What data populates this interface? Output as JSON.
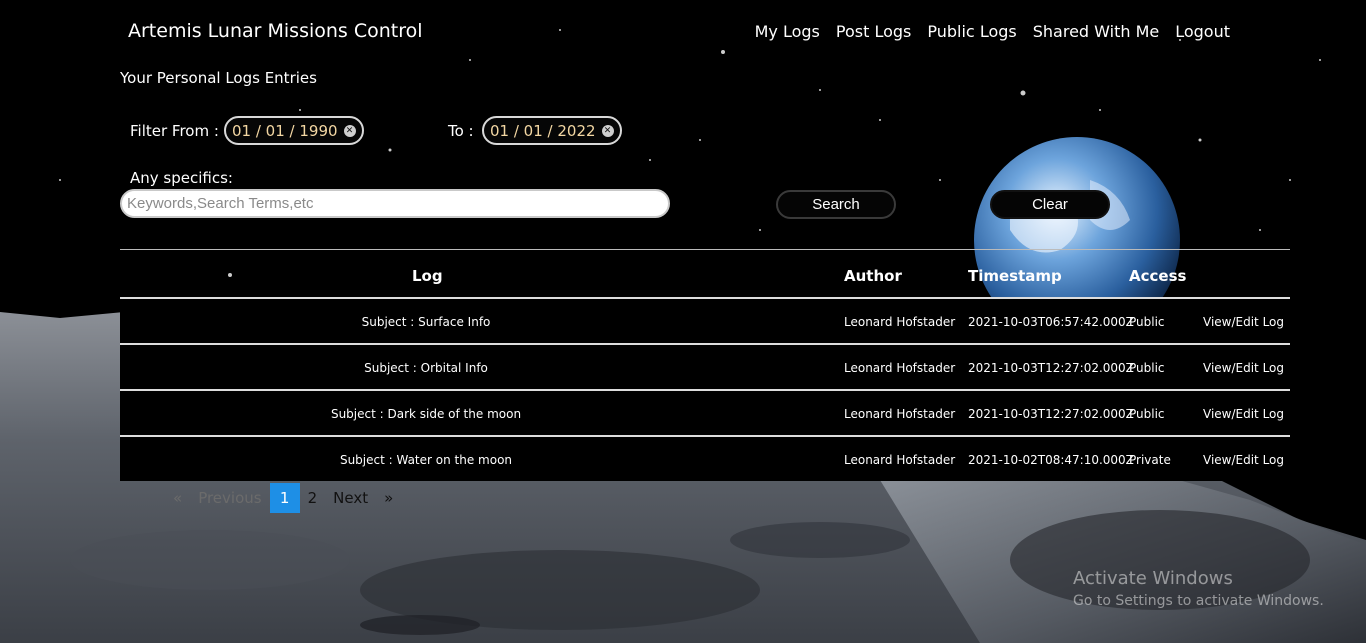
{
  "nav": {
    "brand": "Artemis Lunar Missions Control",
    "links": [
      "My Logs",
      "Post Logs",
      "Public Logs",
      "Shared With Me",
      "Logout"
    ]
  },
  "page": {
    "subtitle": "Your Personal Logs Entries"
  },
  "filters": {
    "from_label": "Filter From :",
    "from_value": "01 / 01 / 1990",
    "to_label": "To :",
    "to_value": "01 / 01 / 2022",
    "specifics_label": "Any specifics:",
    "search_placeholder": "Keywords,Search Terms,etc",
    "search_button": "Search",
    "clear_button": "Clear"
  },
  "table": {
    "headers": {
      "log": "Log",
      "author": "Author",
      "timestamp": "Timestamp",
      "access": "Access"
    },
    "rows": [
      {
        "log": "Subject : Surface Info",
        "author": "Leonard Hofstader",
        "timestamp": "2021-10-03T06:57:42.000Z",
        "access": "Public",
        "action": "View/Edit Log"
      },
      {
        "log": "Subject : Orbital Info",
        "author": "Leonard Hofstader",
        "timestamp": "2021-10-03T12:27:02.000Z",
        "access": "Public",
        "action": "View/Edit Log"
      },
      {
        "log": "Subject : Dark side of the moon",
        "author": "Leonard Hofstader",
        "timestamp": "2021-10-03T12:27:02.000Z",
        "access": "Public",
        "action": "View/Edit Log"
      },
      {
        "log": "Subject : Water on the moon",
        "author": "Leonard Hofstader",
        "timestamp": "2021-10-02T08:47:10.000Z",
        "access": "Private",
        "action": "View/Edit Log"
      }
    ]
  },
  "pagination": {
    "prev_arrow": "«",
    "prev": "Previous",
    "current": "1",
    "page2": "2",
    "next": "Next",
    "next_arrow": "»"
  },
  "watermark": {
    "title": "Activate Windows",
    "subtitle": "Go to Settings to activate Windows."
  },
  "colors": {
    "accent": "#1e8fe6",
    "date_text": "#f3d7a3",
    "background": "#000000"
  }
}
